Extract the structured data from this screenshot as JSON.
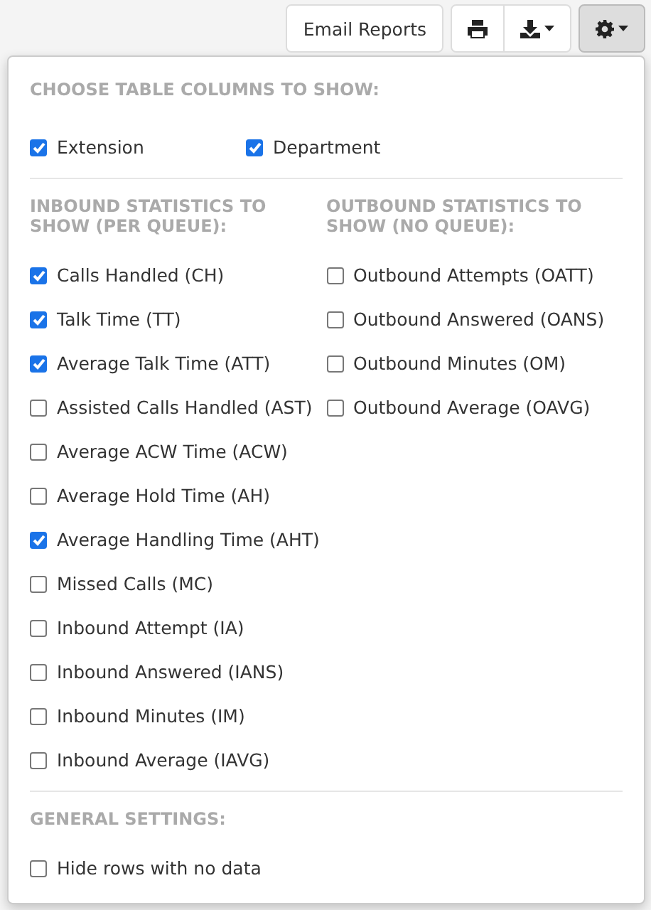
{
  "toolbar": {
    "email_button": "Email Reports"
  },
  "columns_section": {
    "heading": "CHOOSE TABLE COLUMNS TO SHOW:",
    "options": [
      {
        "label": "Extension",
        "checked": true
      },
      {
        "label": "Department",
        "checked": true
      }
    ]
  },
  "inbound_section": {
    "heading": "INBOUND STATISTICS TO SHOW (PER QUEUE):",
    "options": [
      {
        "label": "Calls Handled (CH)",
        "checked": true
      },
      {
        "label": "Talk Time (TT)",
        "checked": true
      },
      {
        "label": "Average Talk Time (ATT)",
        "checked": true
      },
      {
        "label": "Assisted Calls Handled (AST)",
        "checked": false
      },
      {
        "label": "Average ACW Time (ACW)",
        "checked": false
      },
      {
        "label": "Average Hold Time (AH)",
        "checked": false
      },
      {
        "label": "Average Handling Time (AHT)",
        "checked": true
      },
      {
        "label": "Missed Calls (MC)",
        "checked": false
      },
      {
        "label": "Inbound Attempt (IA)",
        "checked": false
      },
      {
        "label": "Inbound Answered (IANS)",
        "checked": false
      },
      {
        "label": "Inbound Minutes (IM)",
        "checked": false
      },
      {
        "label": "Inbound Average (IAVG)",
        "checked": false
      }
    ]
  },
  "outbound_section": {
    "heading": "OUTBOUND STATISTICS TO SHOW (NO QUEUE):",
    "options": [
      {
        "label": "Outbound Attempts (OATT)",
        "checked": false
      },
      {
        "label": "Outbound Answered (OANS)",
        "checked": false
      },
      {
        "label": "Outbound Minutes (OM)",
        "checked": false
      },
      {
        "label": "Outbound Average (OAVG)",
        "checked": false
      }
    ]
  },
  "general_section": {
    "heading": "GENERAL SETTINGS:",
    "options": [
      {
        "label": "Hide rows with no data",
        "checked": false
      }
    ]
  }
}
